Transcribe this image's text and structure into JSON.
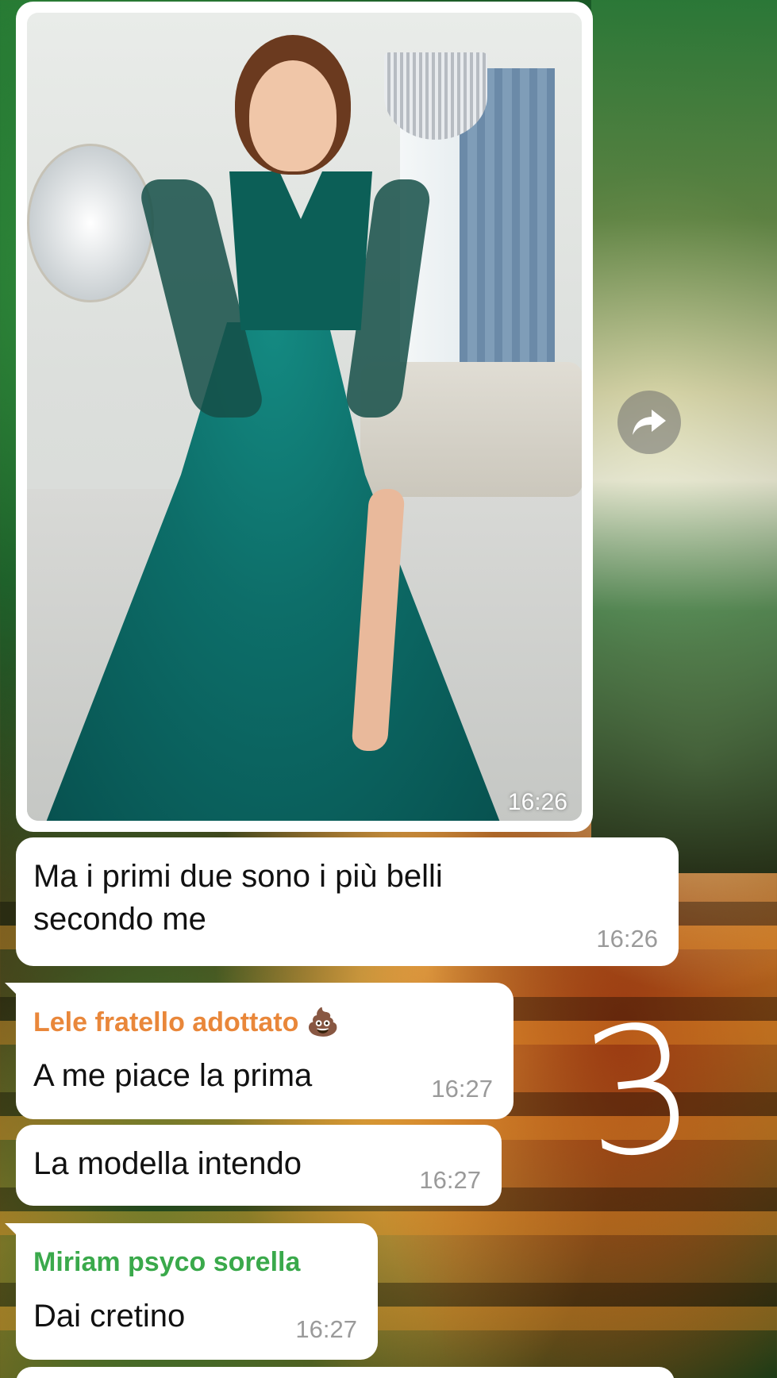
{
  "image_message": {
    "time": "16:26"
  },
  "messages": [
    {
      "text": "Ma i primi due sono i più belli secondo me",
      "time": "16:26"
    },
    {
      "sender": "Lele fratello adottato 💩",
      "text": "A me piace la prima",
      "time": "16:27"
    },
    {
      "text": "La modella intendo",
      "time": "16:27"
    },
    {
      "sender": "Miriam psyco sorella",
      "text": "Dai cretino",
      "time": "16:27"
    }
  ],
  "annotation": "3",
  "colors": {
    "bubble": "#ffffff",
    "sender_lele": "#e9873a",
    "sender_miriam": "#3aa94b",
    "time": "#9a9a9a"
  },
  "icons": {
    "forward": "forward-icon"
  }
}
